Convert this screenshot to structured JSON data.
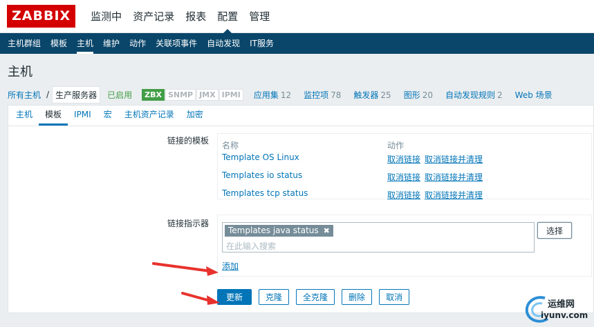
{
  "logo": "ZABBIX",
  "top_menu": [
    {
      "label": "监测中",
      "active": false
    },
    {
      "label": "资产记录",
      "active": false
    },
    {
      "label": "报表",
      "active": false
    },
    {
      "label": "配置",
      "active": true
    },
    {
      "label": "管理",
      "active": false
    }
  ],
  "sub_menu": [
    {
      "label": "主机群组",
      "active": false
    },
    {
      "label": "模板",
      "active": false
    },
    {
      "label": "主机",
      "active": true
    },
    {
      "label": "维护",
      "active": false
    },
    {
      "label": "动作",
      "active": false
    },
    {
      "label": "关联项事件",
      "active": false
    },
    {
      "label": "自动发现",
      "active": false
    },
    {
      "label": "IT服务",
      "active": false
    }
  ],
  "page_title": "主机",
  "breadcrumb": {
    "all_hosts": "所有主机",
    "separator": "/",
    "host": "生产服务器",
    "status": "已启用"
  },
  "availability": [
    {
      "label": "ZBX",
      "on": true
    },
    {
      "label": "SNMP",
      "on": false
    },
    {
      "label": "JMX",
      "on": false
    },
    {
      "label": "IPMI",
      "on": false
    }
  ],
  "host_links": [
    {
      "label": "应用集",
      "count": "12"
    },
    {
      "label": "监控项",
      "count": "78"
    },
    {
      "label": "触发器",
      "count": "25"
    },
    {
      "label": "图形",
      "count": "20"
    },
    {
      "label": "自动发现规则",
      "count": "2"
    },
    {
      "label": "Web 场景",
      "count": ""
    }
  ],
  "tabs": [
    {
      "label": "主机",
      "active": false
    },
    {
      "label": "模板",
      "active": true
    },
    {
      "label": "IPMI",
      "active": false
    },
    {
      "label": "宏",
      "active": false
    },
    {
      "label": "主机资产记录",
      "active": false
    },
    {
      "label": "加密",
      "active": false
    }
  ],
  "linked_templates": {
    "label": "链接的模板",
    "col_name": "名称",
    "col_action": "动作",
    "rows": [
      {
        "name": "Template OS Linux",
        "unlink": "取消链接",
        "unlink_clear": "取消链接并清理"
      },
      {
        "name": "Templates io status",
        "unlink": "取消链接",
        "unlink_clear": "取消链接并清理"
      },
      {
        "name": "Templates tcp status",
        "unlink": "取消链接",
        "unlink_clear": "取消链接并清理"
      }
    ]
  },
  "link_indicator": {
    "label": "链接指示器",
    "selected_chip": "Templates java status",
    "chip_remove": "✖",
    "search_placeholder": "在此输入搜索",
    "select_button": "选择",
    "add_link": "添加"
  },
  "buttons": {
    "update": "更新",
    "clone": "克隆",
    "full_clone": "全克隆",
    "delete": "删除",
    "cancel": "取消"
  },
  "watermark": {
    "line1": "运维网",
    "line2": "iyunv.com"
  },
  "colors": {
    "brand_red": "#d40000",
    "nav_blue": "#0a466a",
    "link_blue": "#0275b8",
    "enabled_green": "#429e47",
    "annotation_red": "#e8322d"
  }
}
